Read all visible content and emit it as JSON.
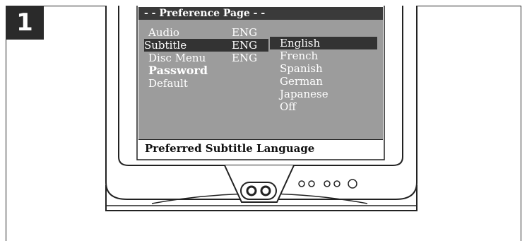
{
  "step": {
    "number": "1"
  },
  "osd": {
    "title": "- - Preference Page - -",
    "menu_items": [
      {
        "label": "Audio",
        "value": "ENG"
      },
      {
        "label": "Subtitle",
        "value": "ENG"
      },
      {
        "label": "Disc Menu",
        "value": "ENG"
      },
      {
        "label": "Password",
        "value": ""
      },
      {
        "label": "Default",
        "value": ""
      }
    ],
    "selected_menu_index": 1,
    "options": [
      "English",
      "French",
      "Spanish",
      "German",
      "Japanese",
      "Off"
    ],
    "selected_option_index": 0,
    "status_text": "Preferred Subtitle Language"
  },
  "colors": {
    "screen_bg": "#9c9c9c",
    "highlight": "#333333",
    "title_bar": "#3a3a3a"
  }
}
